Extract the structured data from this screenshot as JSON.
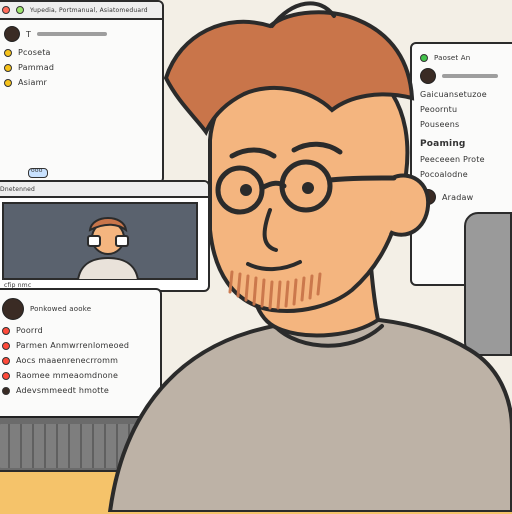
{
  "scene": {
    "description_hidden": "",
    "colors": {
      "skin": "#f4b57f",
      "hair": "#c9754a",
      "shirt": "#bdb2a6",
      "outline": "#2b2b2b",
      "accent_yellow": "#f5c36a"
    },
    "icons": [
      "avatar-icon",
      "status-dot-icon",
      "glasses-icon"
    ]
  },
  "windows": {
    "left_top": {
      "header_text": "Yupedia, Portmanual, Asiatomeduard",
      "items": [
        "T",
        "Pcoseta",
        "Pammad",
        "Asiamr"
      ],
      "pill": "ooo"
    },
    "left_video": {
      "header_text": "Dnetenned",
      "caption_1": "cfip nmc",
      "caption_2": "Ponkowed aooke"
    },
    "left_bottom": {
      "rows": [
        "Poorrd",
        "Parmen  Anmwrrenlomeoed",
        "Aocs maaenrenecrromm",
        "Raomee  mmeaomdnone",
        "Adevsmmeedt hmotte"
      ]
    },
    "right_top": {
      "header_text": "Paoset An",
      "lines": [
        "Gaicuansetuzoe",
        "Peoorntu",
        "Pouseens",
        "Poaming",
        "Peeceeen Prote",
        "Pocoalodne",
        "Aradaw"
      ]
    }
  }
}
